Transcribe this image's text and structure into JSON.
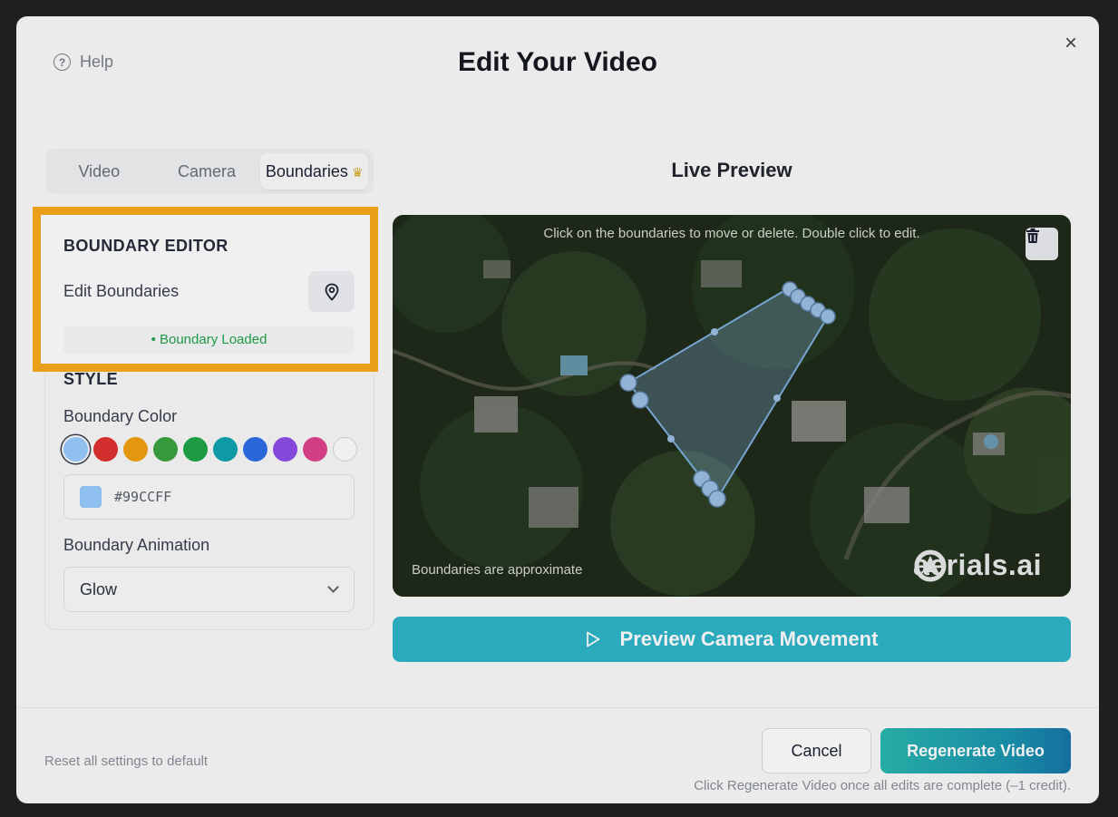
{
  "header": {
    "help_label": "Help",
    "title": "Edit Your Video",
    "close_label": "×"
  },
  "tabs": [
    {
      "label": "Video",
      "active": false
    },
    {
      "label": "Camera",
      "active": false
    },
    {
      "label": "Boundaries",
      "active": true,
      "icon": "crown-icon"
    }
  ],
  "boundary_editor": {
    "heading": "BOUNDARY EDITOR",
    "edit_label": "Edit Boundaries",
    "edit_icon": "map-pin-icon",
    "status": "• Boundary Loaded",
    "status_color": "#22a249",
    "highlight_color": "#f8a91c"
  },
  "style": {
    "heading": "STYLE",
    "color_label": "Boundary Color",
    "swatches": [
      "#99CCFF",
      "#e03131",
      "#f2a10f",
      "#3aa33f",
      "#1fa548",
      "#0fa3b1",
      "#2f6ee8",
      "#8d4de8",
      "#e0428c",
      "#ffffff"
    ],
    "selected_swatch": "#99CCFF",
    "hex_value": "#99CCFF",
    "animation_label": "Boundary Animation",
    "animation_value": "Glow"
  },
  "preview": {
    "title": "Live Preview",
    "hint": "Click on the boundaries to move or delete. Double click to edit.",
    "approx_note": "Boundaries are approximate",
    "logo_text": "aerials.ai",
    "button_label": "Preview Camera Movement",
    "accent": "#2eb5c9"
  },
  "footer": {
    "reset_label": "Reset all settings to default",
    "cancel_label": "Cancel",
    "regenerate_label": "Regenerate Video",
    "note": "Click Regenerate Video once all edits are complete (–1 credit)."
  }
}
